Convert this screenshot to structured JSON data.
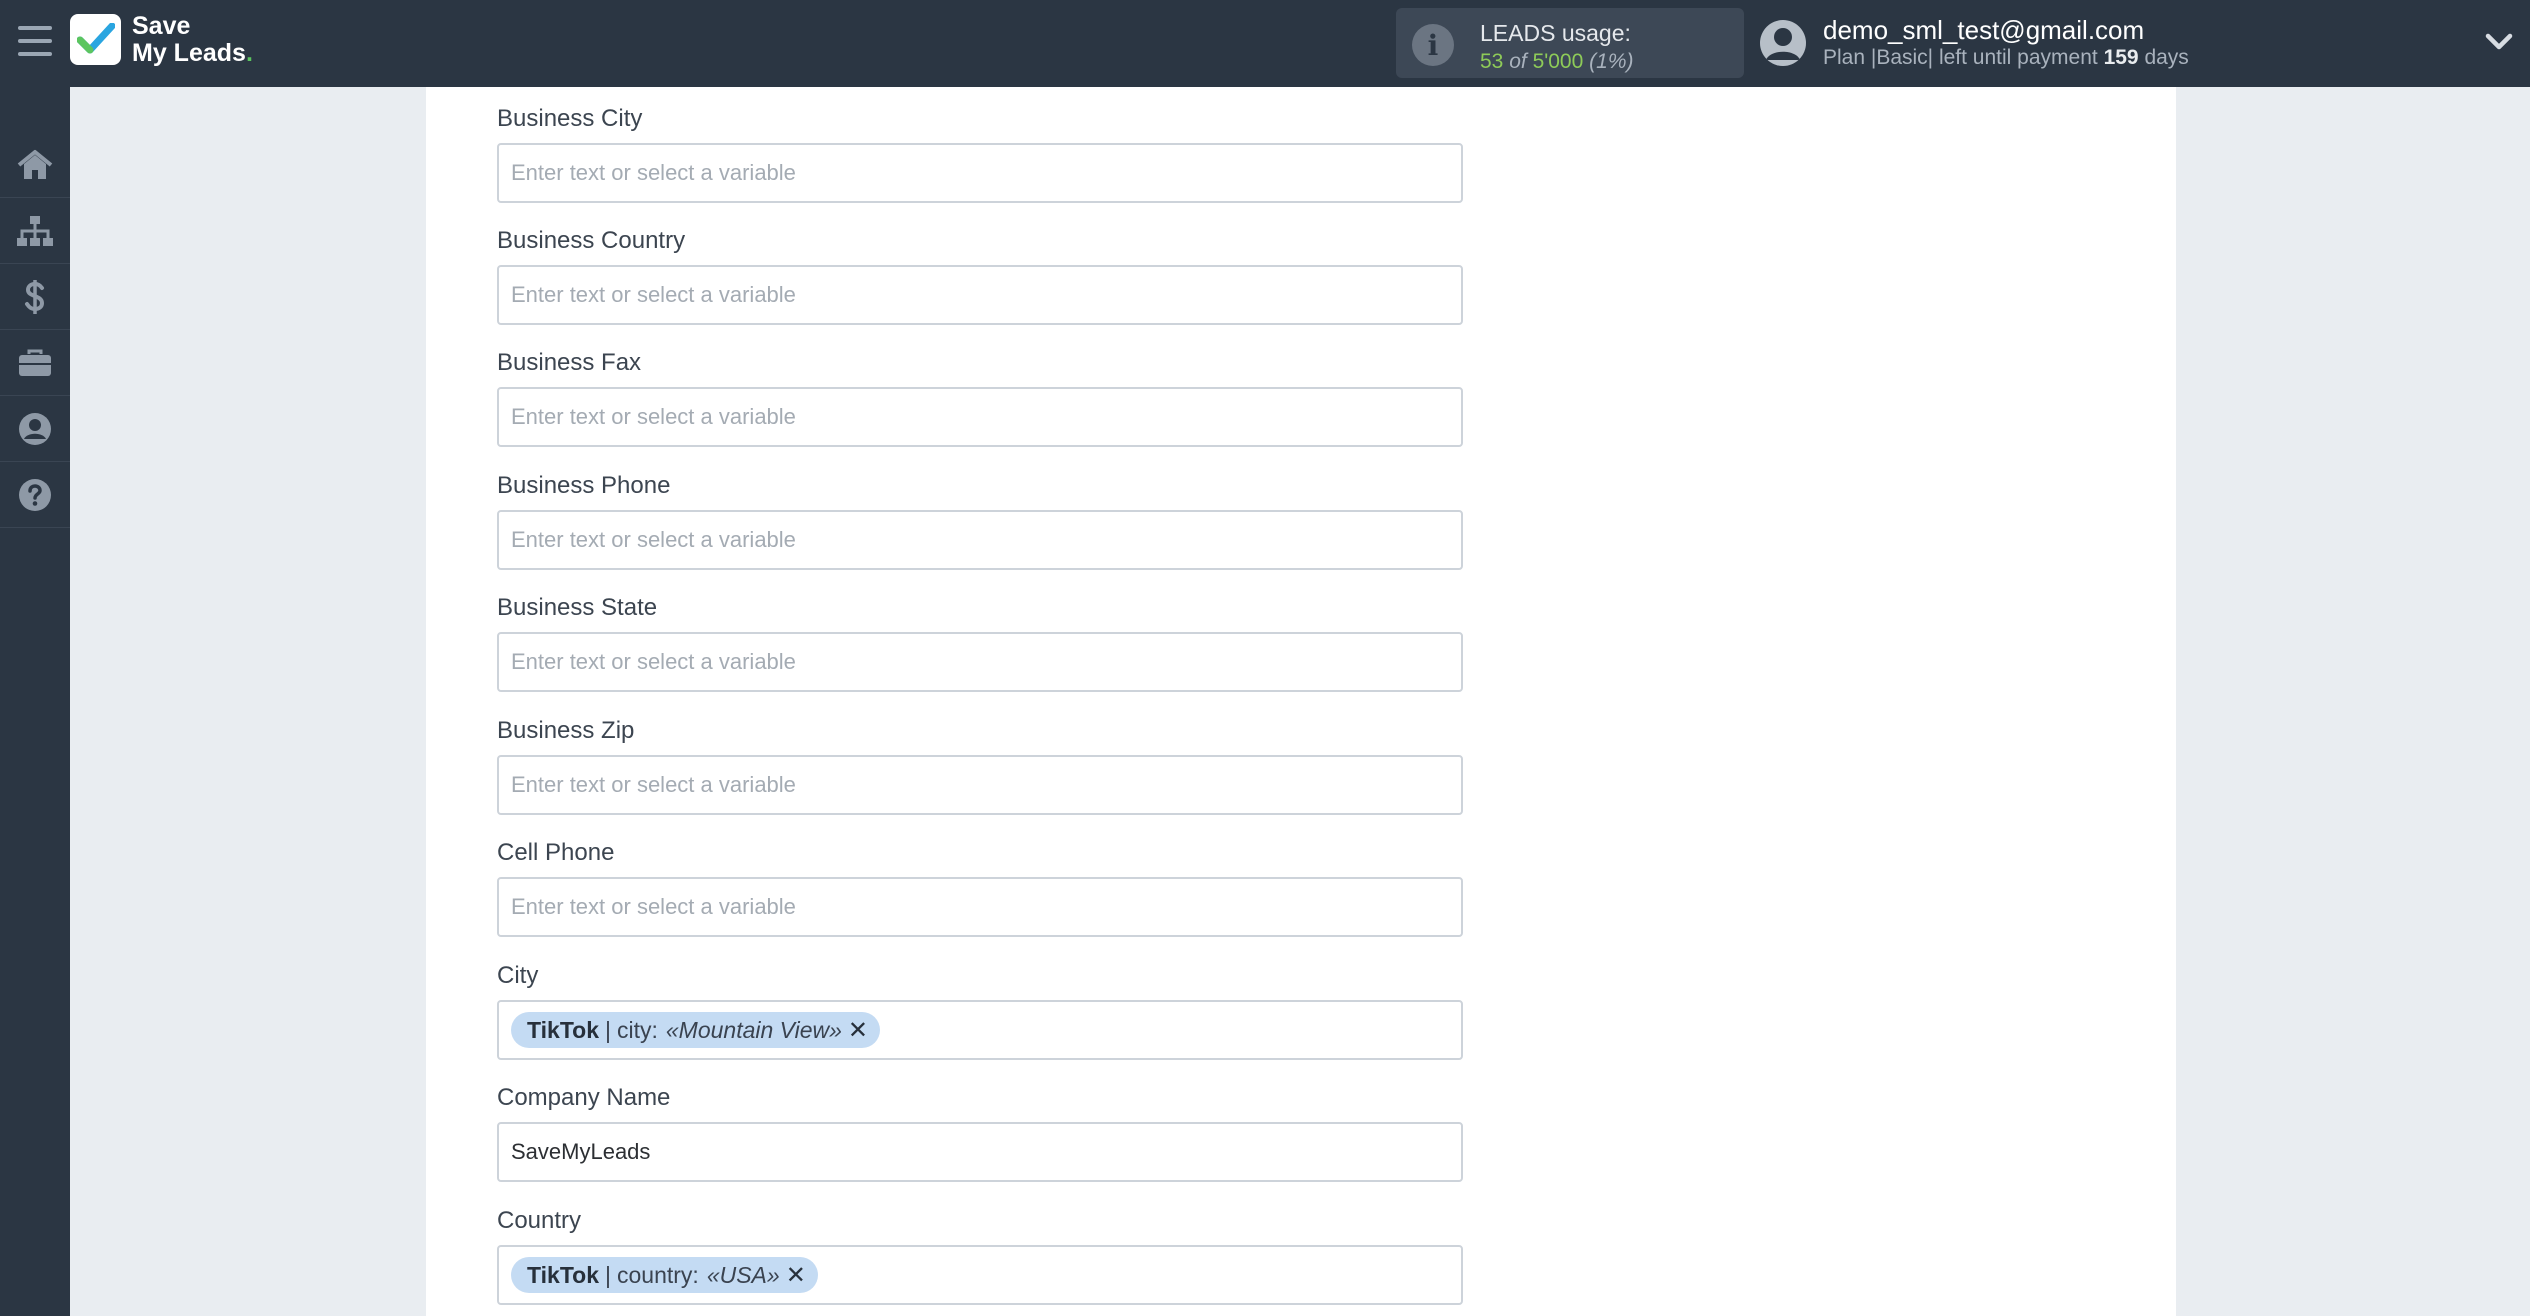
{
  "brand": {
    "line1": "Save",
    "line2": "My Leads",
    "dot": "."
  },
  "usage": {
    "title": "LEADS usage:",
    "used": "53",
    "of": "of",
    "total": "5'000",
    "percent": "(1%)"
  },
  "user": {
    "email": "demo_sml_test@gmail.com",
    "plan_prefix": "Plan |Basic| left until payment",
    "days": "159",
    "days_suffix": "days"
  },
  "sidebar": {
    "items": [
      {
        "name": "home-icon"
      },
      {
        "name": "sitemap-icon"
      },
      {
        "name": "dollar-icon"
      },
      {
        "name": "briefcase-icon"
      },
      {
        "name": "user-circle-icon"
      },
      {
        "name": "help-icon"
      }
    ]
  },
  "form": {
    "placeholder": "Enter text or select a variable",
    "fields": [
      {
        "label": "Business City",
        "value": ""
      },
      {
        "label": "Business Country",
        "value": ""
      },
      {
        "label": "Business Fax",
        "value": ""
      },
      {
        "label": "Business Phone",
        "value": ""
      },
      {
        "label": "Business State",
        "value": ""
      },
      {
        "label": "Business Zip",
        "value": ""
      },
      {
        "label": "Cell Phone",
        "value": ""
      },
      {
        "label": "City",
        "chip": {
          "source": "TikTok",
          "sep": "|",
          "field": "city:",
          "sample": "«Mountain View»"
        }
      },
      {
        "label": "Company Name",
        "value": "SaveMyLeads"
      },
      {
        "label": "Country",
        "chip": {
          "source": "TikTok",
          "sep": "|",
          "field": "country:",
          "sample": "«USA»"
        }
      }
    ]
  },
  "colors": {
    "topbar": "#2b3643",
    "chip": "#c4dbf3",
    "accent_green": "#5cc55f"
  }
}
